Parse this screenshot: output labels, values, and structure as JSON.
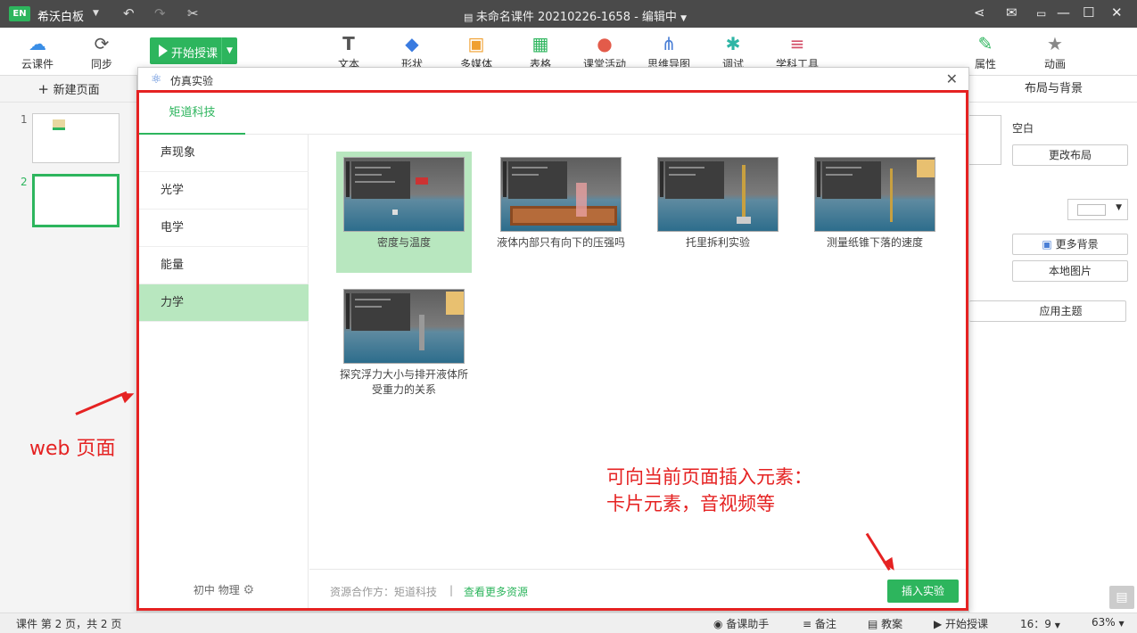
{
  "titlebar": {
    "logo": "EN",
    "app_name": "希沃白板",
    "doc_title": "未命名课件 20210226-1658 - 编辑中"
  },
  "toolbar": {
    "cloud": "云课件",
    "sync": "同步",
    "start_class": "开始授课",
    "tools": [
      "文本",
      "形状",
      "多媒体",
      "表格",
      "课堂活动",
      "思维导图",
      "调试",
      "学科工具"
    ],
    "property": "属性",
    "animation": "动画"
  },
  "left_panel": {
    "new_page": "新建页面",
    "thumbnails": [
      "1",
      "2"
    ]
  },
  "right_panel": {
    "tab": "布局与背景",
    "empty_label": "空白",
    "change_layout": "更改布局",
    "more_background": "更多背景",
    "local_image": "本地图片",
    "apply_theme": "应用主题"
  },
  "dialog": {
    "title": "仿真实验",
    "tab": "矩道科技",
    "categories": [
      "声现象",
      "光学",
      "电学",
      "能量",
      "力学"
    ],
    "active_category": "力学",
    "filter": "初中 物理",
    "experiments": [
      {
        "label": "密度与温度",
        "selected": true
      },
      {
        "label": "液体内部只有向下的压强吗",
        "selected": false
      },
      {
        "label": "托里拆利实验",
        "selected": false
      },
      {
        "label": "测量纸锥下落的速度",
        "selected": false
      },
      {
        "label": "探究浮力大小与排开液体所受重力的关系",
        "selected": false
      }
    ],
    "source": "资源合作方：矩道科技",
    "separator": "|",
    "more_resources": "查看更多资源",
    "insert_button": "插入实验"
  },
  "annotations": {
    "web_page": "web 页面",
    "insert_hint_line1": "可向当前页面插入元素：",
    "insert_hint_line2": "卡片元素，音视频等"
  },
  "statusbar": {
    "page_info": "课件 第 2 页，共 2 页",
    "assistant": "备课助手",
    "notes": "备注",
    "lesson_plan": "教案",
    "start_class": "开始授课",
    "ratio": "16：9",
    "zoom": "63%"
  },
  "colors": {
    "accent": "#2db55d",
    "selected_bg": "#b8e7bf",
    "annotation": "#e52222",
    "titlebar": "#4a4a4a"
  }
}
